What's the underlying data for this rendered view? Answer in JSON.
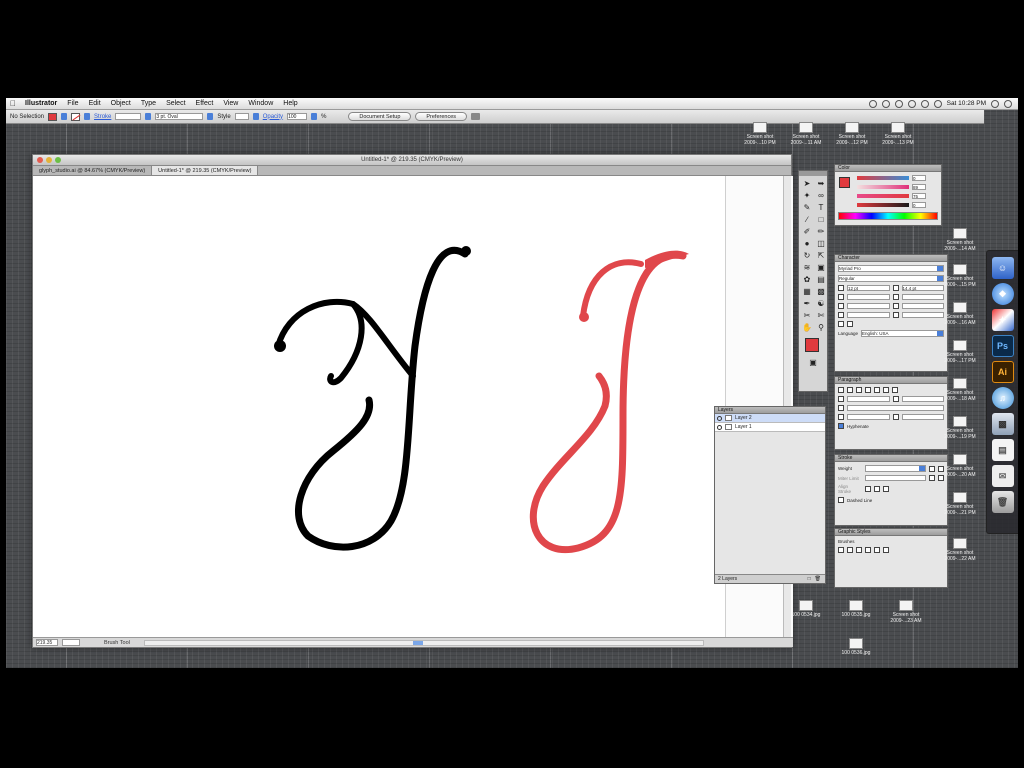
{
  "menubar": {
    "items": [
      "Illustrator",
      "File",
      "Edit",
      "Object",
      "Type",
      "Select",
      "Effect",
      "View",
      "Window",
      "Help"
    ],
    "clock": "Sat 10:28 PM"
  },
  "controlbar": {
    "selection": "No Selection",
    "stroke_label": "Stroke",
    "brush_value": "3 pt. Oval",
    "style_label": "Style",
    "opacity_label": "Opacity",
    "opacity_value": "100",
    "opacity_unit": "%",
    "document_setup": "Document Setup",
    "preferences": "Preferences"
  },
  "document": {
    "title": "Untitled-1* @ 219.35 (CMYK/Preview)",
    "tabs": [
      "glyph_studio.ai @ 84.67% (CMYK/Preview)",
      "Untitled-1* @ 219.35 (CMYK/Preview)"
    ],
    "zoom": "219.35",
    "status_text": "Brush Tool",
    "fill_color": "#e03a3e"
  },
  "color_panel": {
    "title": "Color",
    "values": [
      "0",
      "89",
      "75",
      "0"
    ]
  },
  "character_panel": {
    "title": "Character",
    "font": "Myriad Pro",
    "style": "Regular",
    "size": "12 pt",
    "leading": "14.4 pt",
    "language_label": "Language",
    "language": "English: USA"
  },
  "paragraph_panel": {
    "title": "Paragraph",
    "hyphenate": "Hyphenate"
  },
  "stroke_panel": {
    "title": "Stroke",
    "weight_label": "Weight",
    "miter_label": "Miter Limit",
    "align_label": "Align Stroke",
    "dashed": "Dashed Line"
  },
  "graphic_panel": {
    "title": "Graphic Styles",
    "sub": "Brushes"
  },
  "layers_panel": {
    "title": "Layers",
    "rows": [
      "Layer 2",
      "Layer 1"
    ],
    "footer": "2 Layers"
  },
  "dock": {
    "apps": [
      "Ps",
      "Ai"
    ]
  },
  "desktop_files": [
    "Screen shot 2009-...10 PM",
    "Screen shot 2009-...11 AM",
    "Screen shot 2009-...12 PM",
    "Screen shot 2009-...13 PM",
    "Screen shot 2009-...14 AM",
    "Screen shot 2009-...15 PM",
    "Screen shot 2009-...16 AM",
    "Screen shot 2009-...17 PM",
    "Screen shot 2009-...18 AM",
    "Screen shot 2009-...19 PM",
    "Screen shot 2009-...20 AM",
    "Screen shot 2009-...21 PM",
    "Screen shot 2009-...22 AM",
    "Screen shot 2009-...23 AM",
    "100 0534.jpg",
    "100 0535.jpg",
    "100 0536.jpg"
  ],
  "letters": {
    "left_color": "#000000",
    "right_color": "#e0474b"
  }
}
